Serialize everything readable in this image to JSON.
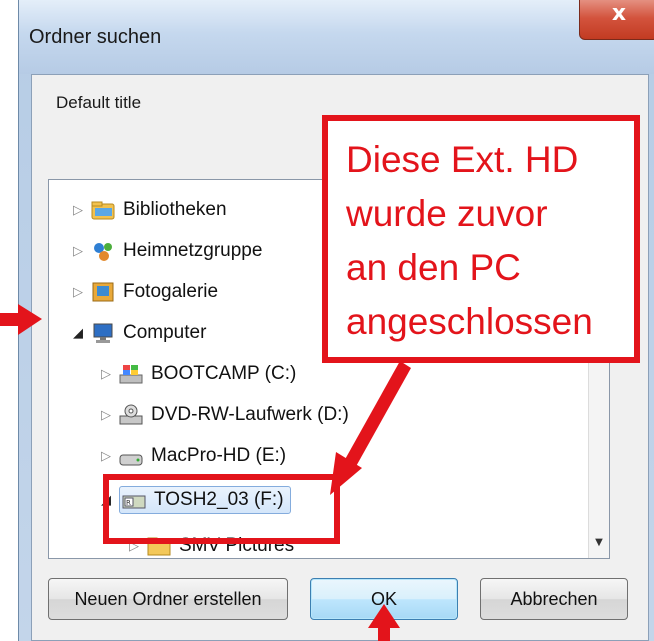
{
  "window": {
    "title": "Ordner suchen",
    "close_glyph": "x"
  },
  "dialog": {
    "default_title": "Default title"
  },
  "tree": [
    {
      "label": "Bibliotheken",
      "icon": "libraries-icon",
      "expanded": false
    },
    {
      "label": "Heimnetzgruppe",
      "icon": "homegroup-icon",
      "expanded": false
    },
    {
      "label": "Fotogalerie",
      "icon": "photo-gallery-icon",
      "expanded": false
    },
    {
      "label": "Computer",
      "icon": "computer-icon",
      "expanded": true
    },
    {
      "label": "BOOTCAMP (C:)",
      "icon": "windows-drive-icon",
      "expanded": false
    },
    {
      "label": "DVD-RW-Laufwerk (D:)",
      "icon": "dvd-drive-icon",
      "expanded": false
    },
    {
      "label": "MacPro-HD (E:)",
      "icon": "hard-drive-icon",
      "expanded": false
    },
    {
      "label": "TOSH2_03 (F:)",
      "icon": "external-drive-icon",
      "expanded": true,
      "selected": true
    },
    {
      "label": "SMV Pictures",
      "icon": "folder-icon",
      "expanded": false
    }
  ],
  "buttons": {
    "new_folder": "Neuen Ordner erstellen",
    "ok": "OK",
    "cancel": "Abbrechen"
  },
  "annotation": {
    "callout": "Diese Ext. HD\nwurde zuvor\nan den PC\nangeschlossen",
    "color": "#e3141b"
  }
}
